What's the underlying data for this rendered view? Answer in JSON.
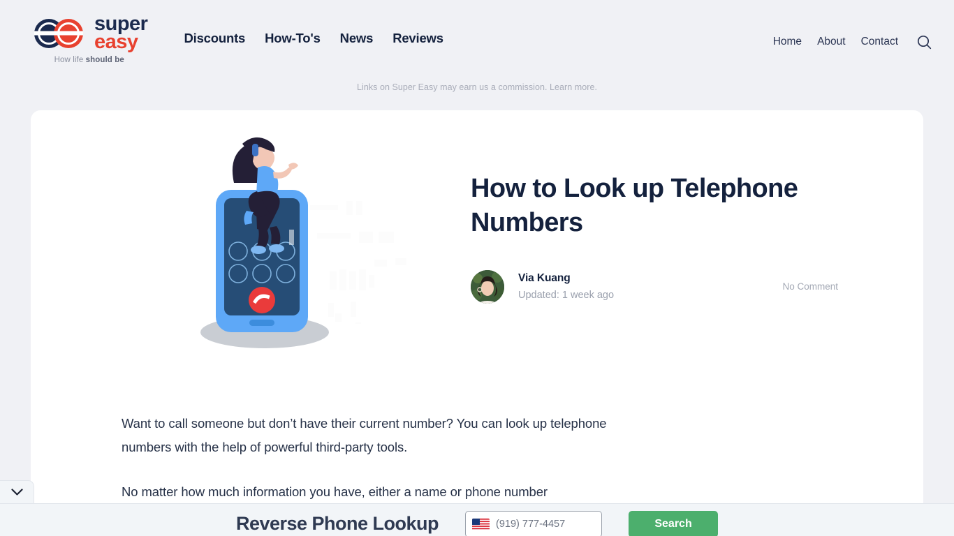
{
  "header": {
    "brand": {
      "super": "super",
      "easy": "easy",
      "tagline_prefix": "How life ",
      "tagline_bold": "should be"
    },
    "main_nav": [
      {
        "label": "Discounts"
      },
      {
        "label": "How-To's"
      },
      {
        "label": "News"
      },
      {
        "label": "Reviews"
      }
    ],
    "util_nav": [
      {
        "label": "Home"
      },
      {
        "label": "About"
      },
      {
        "label": "Contact"
      }
    ],
    "search_icon": "search-icon"
  },
  "disclaimer": "Links on Super Easy may earn us a commission. Learn more.",
  "article": {
    "title": "How to Look up Telephone Numbers",
    "author": "Via Kuang",
    "updated": "Updated: 1 week ago",
    "comments": "No Comment",
    "paragraphs": [
      "Want to call someone but don’t have their current number? You can look up telephone numbers with the help of powerful third-party tools.",
      "No matter how much information you have, either a name or phone number"
    ]
  },
  "sticky_bar": {
    "title": "Reverse Phone Lookup",
    "phone_placeholder": "(919) 777-4457",
    "search_label": "Search",
    "collapse_icon": "chevron-down-icon",
    "flag_icon": "us-flag-icon"
  },
  "colors": {
    "page_bg": "#f0f1f5",
    "card_bg": "#ffffff",
    "navy": "#14213d",
    "red": "#e8412f",
    "green": "#4caf6d",
    "muted": "#9aa0ad"
  }
}
